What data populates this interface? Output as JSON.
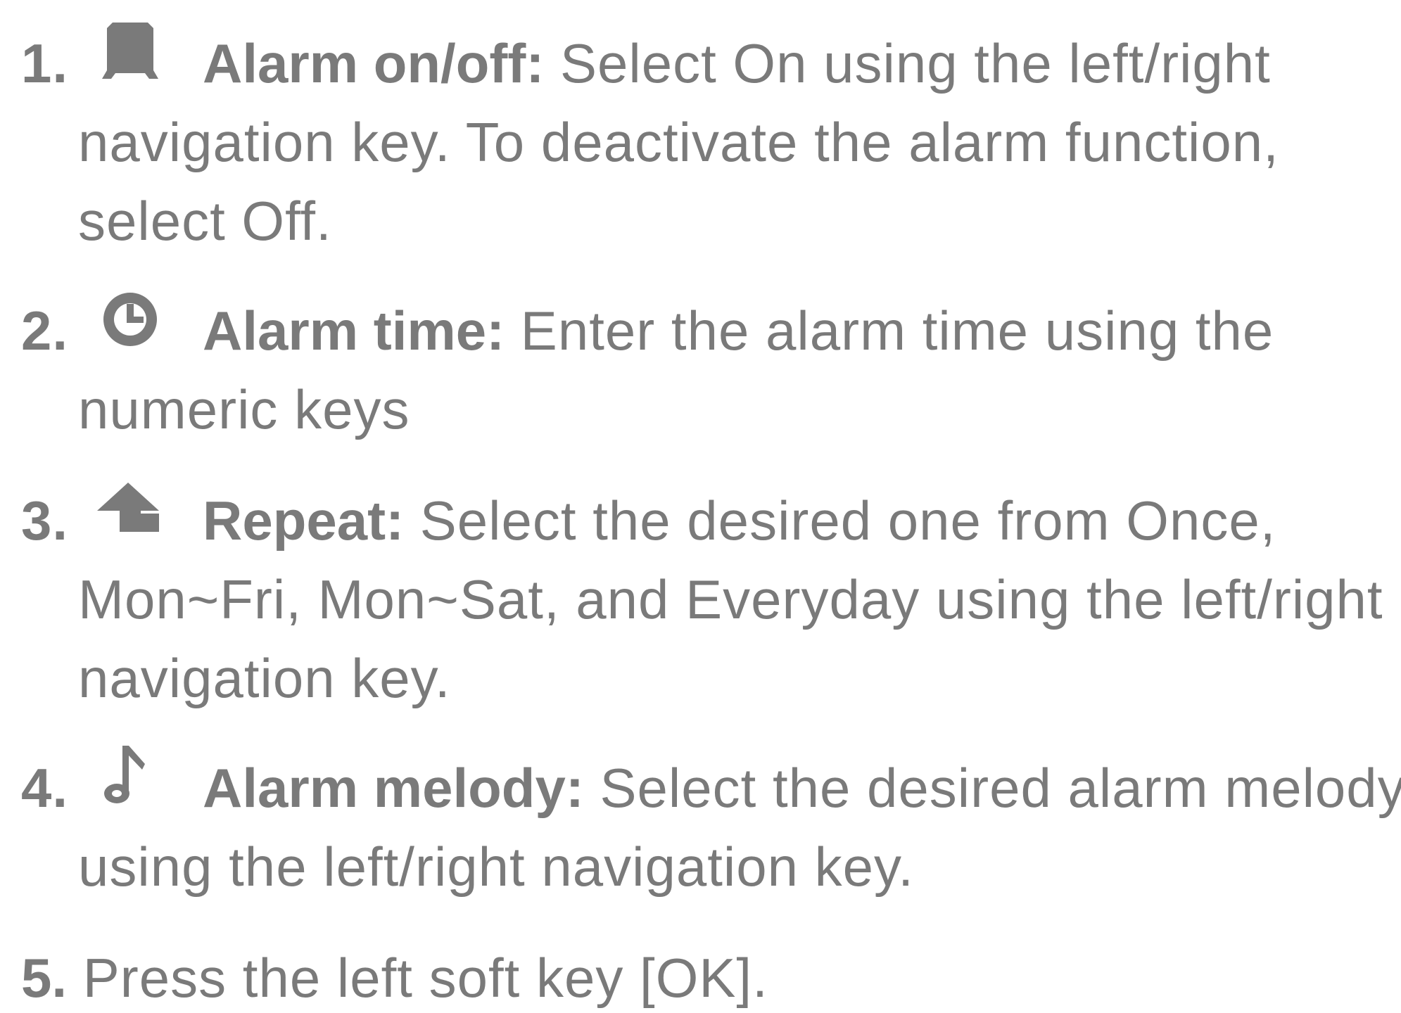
{
  "steps": [
    {
      "number": "1.",
      "icon": "alarm-onoff-icon",
      "term": "Alarm on/off:",
      "lines": [
        " Select On using the left/right",
        "navigation key. To deactivate the alarm function,",
        "select Off."
      ]
    },
    {
      "number": "2.",
      "icon": "clock-icon",
      "term": "Alarm time:",
      "lines": [
        " Enter the alarm time using the",
        "numeric keys"
      ]
    },
    {
      "number": "3.",
      "icon": "repeat-arrow-icon",
      "term": "Repeat:",
      "lines": [
        " Select the desired one from Once,",
        "Mon~Fri, Mon~Sat, and Everyday using the left/right",
        "navigation key."
      ]
    },
    {
      "number": "4.",
      "icon": "music-note-icon",
      "term": "Alarm melody:",
      "lines": [
        " Select the desired alarm melody",
        "using the left/right navigation key."
      ]
    },
    {
      "number": "5.",
      "text": " Press the left soft key [OK]."
    }
  ],
  "colors": {
    "text": "#7a7a7a",
    "icon": "#7a7a7a",
    "background": "#ffffff"
  }
}
